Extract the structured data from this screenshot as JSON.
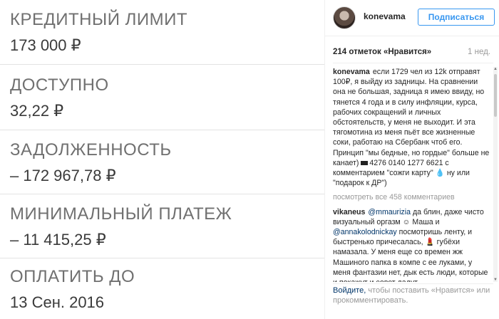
{
  "card": {
    "fields": [
      {
        "label": "КРЕДИТНЫЙ ЛИМИТ",
        "value": "173 000 ₽"
      },
      {
        "label": "ДОСТУПНО",
        "value": "32,22 ₽"
      },
      {
        "label": "ЗАДОЛЖЕННОСТЬ",
        "value": "– 172 967,78 ₽"
      },
      {
        "label": "МИНИМАЛЬНЫЙ ПЛАТЕЖ",
        "value": "– 11 415,25 ₽"
      },
      {
        "label": "ОПЛАТИТЬ ДО",
        "value": "13 Сен. 2016"
      }
    ]
  },
  "instagram": {
    "username": "konevama",
    "follow_label": "Подписаться",
    "likes": "214 отметок «Нравится»",
    "age": "1 нед.",
    "caption": {
      "user": "konevama",
      "text_1": "если 1729 чел из 12k отправят 100₽, я выйду из задницы. На сравнении она не большая, задница я имею ввиду, но тянется 4 года и в силу инфляции, курса, рабочих сокращений и личных обстоятельств, у меня не выходит. И эта тягомотина из меня пьёт все жизненные соки, работаю на Сбербанк чтоб его. Принцип \"мы бедные, но гордые\" больше не канает)",
      "text_2": "4276 0140 1277 6621 с комментарием \"сожги карту\"",
      "text_3": "ну или \"подарок к ДР\")"
    },
    "view_all": "посмотреть все 458 комментариев",
    "comment": {
      "user": "vikaneus",
      "mention_1": "@mmaurizia",
      "text_1": "да блин, даже чисто визуальный оргазм ☺ Маша и",
      "mention_2": "@annakolodnickay",
      "text_2": "посмотришь ленту, и быстренько причесалась, 💄 губёхи намазала. У меня еще со времен жж Машиного папка в компе с ее луками, у меня фантазии нет, дык есть люди, которые и покажут и совет дадут - ..."
    },
    "footer": {
      "login": "Войдите,",
      "rest": "чтобы поставить «Нравится» или прокомментировать."
    },
    "icons": {
      "avatar": "profile-photo",
      "drop": "💧"
    }
  }
}
